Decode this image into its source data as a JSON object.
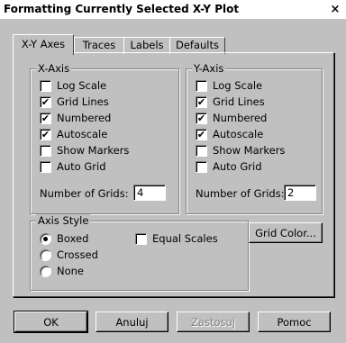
{
  "window": {
    "title": "Formatting Currently Selected X-Y Plot",
    "close_glyph": "×"
  },
  "tabs": [
    {
      "label": "X-Y Axes",
      "active": true
    },
    {
      "label": "Traces",
      "active": false
    },
    {
      "label": "Labels",
      "active": false
    },
    {
      "label": "Defaults",
      "active": false
    }
  ],
  "x_axis": {
    "title": "X-Axis",
    "options": [
      {
        "label": "Log Scale",
        "checked": false
      },
      {
        "label": "Grid Lines",
        "checked": true
      },
      {
        "label": "Numbered",
        "checked": true
      },
      {
        "label": "Autoscale",
        "checked": true
      },
      {
        "label": "Show Markers",
        "checked": false
      },
      {
        "label": "Auto Grid",
        "checked": false
      }
    ],
    "grids_label": "Number of Grids:",
    "grids_value": "4"
  },
  "y_axis": {
    "title": "Y-Axis",
    "options": [
      {
        "label": "Log Scale",
        "checked": false
      },
      {
        "label": "Grid Lines",
        "checked": true
      },
      {
        "label": "Numbered",
        "checked": true
      },
      {
        "label": "Autoscale",
        "checked": true
      },
      {
        "label": "Show Markers",
        "checked": false
      },
      {
        "label": "Auto Grid",
        "checked": false
      }
    ],
    "grids_label": "Number of Grids:",
    "grids_value": "2"
  },
  "axis_style": {
    "title": "Axis Style",
    "options": [
      {
        "label": "Boxed",
        "selected": true
      },
      {
        "label": "Crossed",
        "selected": false
      },
      {
        "label": "None",
        "selected": false
      }
    ],
    "equal_scales_label": "Equal Scales",
    "equal_scales_checked": false
  },
  "grid_color_button": "Grid Color...",
  "buttons": {
    "ok": "OK",
    "cancel": "Anuluj",
    "apply": "Zastosuj",
    "help": "Pomoc"
  },
  "check_glyph": "✔"
}
